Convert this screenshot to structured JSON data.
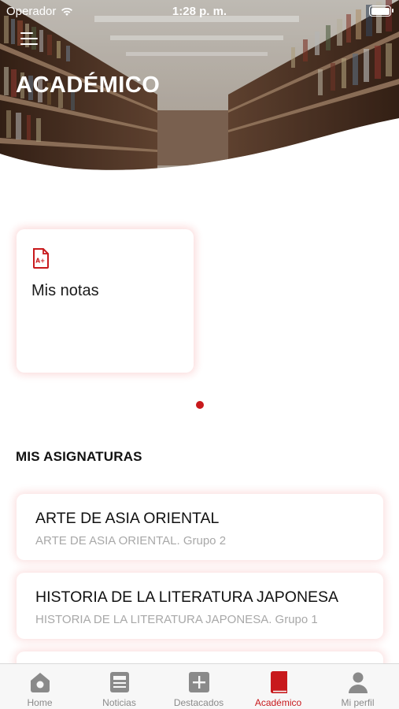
{
  "status_bar": {
    "carrier": "Operador",
    "time": "1:28 p. m."
  },
  "header": {
    "title": "ACADÉMICO"
  },
  "cards": [
    {
      "label": "Mis notas",
      "icon": "grade-a-plus-icon"
    }
  ],
  "section_title": "MIS ASIGNATURAS",
  "subjects": [
    {
      "name": "ARTE DE ASIA ORIENTAL",
      "group": "ARTE DE ASIA ORIENTAL. Grupo 2"
    },
    {
      "name": "HISTORIA DE LA LITERATURA JAPONESA",
      "group": "HISTORIA DE LA LITERATURA JAPONESA. Grupo 1"
    }
  ],
  "tabbar": {
    "items": [
      {
        "label": "Home",
        "icon": "home-icon"
      },
      {
        "label": "Noticias",
        "icon": "news-icon"
      },
      {
        "label": "Destacados",
        "icon": "plus-square-icon"
      },
      {
        "label": "Académico",
        "icon": "book-icon"
      },
      {
        "label": "Mi perfil",
        "icon": "user-icon"
      }
    ],
    "active_index": 3
  },
  "colors": {
    "accent": "#c8191c",
    "tab_inactive": "#8a8a8a",
    "subtitle": "#a8a8a8"
  }
}
